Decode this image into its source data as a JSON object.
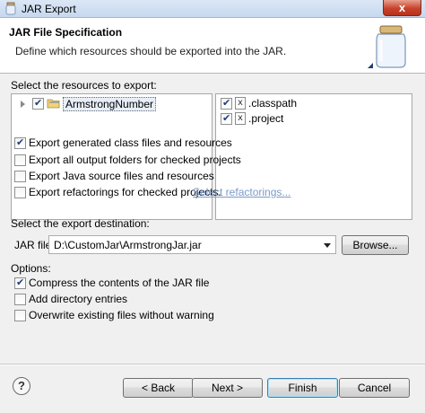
{
  "window": {
    "title": "JAR Export",
    "close_label": "x"
  },
  "header": {
    "title": "JAR File Specification",
    "description": "Define which resources should be exported into the JAR."
  },
  "resources": {
    "label": "Select the resources to export:",
    "tree": [
      {
        "label": "ArmstrongNumber",
        "checked": true,
        "icon": "project-folder-icon"
      }
    ],
    "files": [
      {
        "label": ".classpath",
        "checked": true,
        "icon": "file-icon"
      },
      {
        "label": ".project",
        "checked": true,
        "icon": "file-icon"
      }
    ]
  },
  "export_options": [
    {
      "label": "Export generated class files and resources",
      "checked": true
    },
    {
      "label": "Export all output folders for checked projects",
      "checked": false
    },
    {
      "label": "Export Java source files and resources",
      "checked": false
    },
    {
      "label": "Export refactorings for checked projects.",
      "checked": false
    }
  ],
  "select_refactorings_link": "Select refactorings...",
  "destination": {
    "label": "Select the export destination:",
    "jar_file_label": "JAR file:",
    "jar_file_value": "D:\\CustomJar\\ArmstrongJar.jar",
    "browse_label": "Browse..."
  },
  "options": {
    "label": "Options:",
    "items": [
      {
        "label": "Compress the contents of the JAR file",
        "checked": true
      },
      {
        "label": "Add directory entries",
        "checked": false
      },
      {
        "label": "Overwrite existing files without warning",
        "checked": false
      }
    ]
  },
  "footer": {
    "help_symbol": "?",
    "back_label": "< Back",
    "next_label": "Next >",
    "finish_label": "Finish",
    "cancel_label": "Cancel"
  }
}
